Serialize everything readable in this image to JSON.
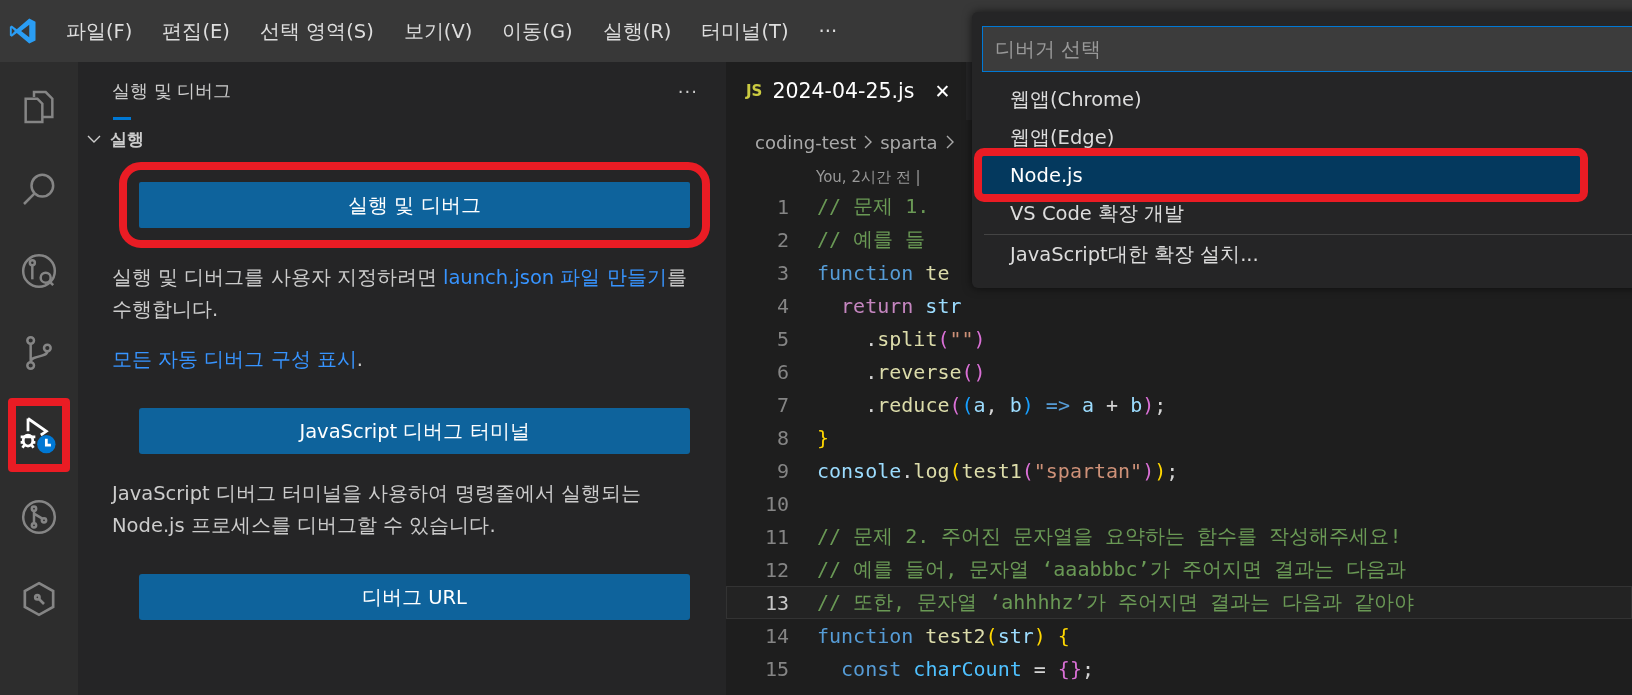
{
  "menu_bar": {
    "items": [
      "파일(F)",
      "편집(E)",
      "선택 영역(S)",
      "보기(V)",
      "이동(G)",
      "실행(R)",
      "터미널(T)"
    ],
    "more": "···"
  },
  "activity_bar": [
    {
      "kind": "files",
      "selected": false,
      "annotated": false
    },
    {
      "kind": "search",
      "selected": false,
      "annotated": false
    },
    {
      "kind": "remote",
      "selected": false,
      "annotated": false
    },
    {
      "kind": "source-control",
      "selected": false,
      "annotated": false
    },
    {
      "kind": "run-debug",
      "selected": true,
      "annotated": true
    },
    {
      "kind": "branch-circle",
      "selected": false,
      "annotated": false
    },
    {
      "kind": "hexagon",
      "selected": false,
      "annotated": false
    }
  ],
  "sidebar": {
    "title": "실행 및 디버그",
    "more": "···",
    "section": {
      "label": "실행",
      "expanded": true
    },
    "blocks": [
      {
        "kind": "button",
        "label": "실행 및 디버그",
        "annotated": true
      },
      {
        "kind": "paragraph",
        "parts": [
          {
            "kind": "text",
            "text": "실행 및 디버그를 사용자 지정하려면 "
          },
          {
            "kind": "link",
            "text": "launch.json 파일 만들기"
          },
          {
            "kind": "text",
            "text": "를 수행합니다."
          }
        ]
      },
      {
        "kind": "paragraph",
        "parts": [
          {
            "kind": "link",
            "text": "모든 자동 디버그 구성 표시"
          },
          {
            "kind": "text",
            "text": "."
          }
        ]
      },
      {
        "kind": "button",
        "label": "JavaScript 디버그 터미널",
        "annotated": false
      },
      {
        "kind": "paragraph",
        "parts": [
          {
            "kind": "text",
            "text": "JavaScript 디버그 터미널을 사용하여 명령줄에서 실행되는 Node.js 프로세스를 디버그할 수 있습니다."
          }
        ]
      },
      {
        "kind": "button",
        "label": "디버그 URL",
        "annotated": false
      }
    ]
  },
  "tabs": [
    {
      "badge": "JS",
      "label": "2024-04-25.js",
      "selected": true,
      "close": "✕"
    }
  ],
  "breadcrumb": [
    "coding-test",
    "sparta"
  ],
  "editor": {
    "code_lens": "You, 2시간 전 |",
    "lines": [
      {
        "number": "1",
        "current": false,
        "tokens": [
          {
            "kind": "comment",
            "text": "// 문제 1."
          }
        ]
      },
      {
        "number": "2",
        "current": false,
        "tokens": [
          {
            "kind": "comment",
            "text": "// 예를 들"
          }
        ]
      },
      {
        "number": "3",
        "current": false,
        "tokens": [
          {
            "kind": "keyword",
            "text": "function"
          },
          {
            "kind": "func",
            "text": " te"
          }
        ]
      },
      {
        "number": "4",
        "current": false,
        "tokens": [
          {
            "kind": "control",
            "text": "  return"
          },
          {
            "kind": "var",
            "text": " str"
          }
        ]
      },
      {
        "number": "5",
        "current": false,
        "tokens": [
          {
            "kind": "plain",
            "text": "    ."
          },
          {
            "kind": "func",
            "text": "split"
          },
          {
            "kind": "bracket2",
            "text": "("
          },
          {
            "kind": "string",
            "text": "\"\""
          },
          {
            "kind": "bracket2",
            "text": ")"
          }
        ]
      },
      {
        "number": "6",
        "current": false,
        "tokens": [
          {
            "kind": "plain",
            "text": "    ."
          },
          {
            "kind": "func",
            "text": "reverse"
          },
          {
            "kind": "bracket2",
            "text": "()"
          }
        ]
      },
      {
        "number": "7",
        "current": false,
        "tokens": [
          {
            "kind": "plain",
            "text": "    ."
          },
          {
            "kind": "func",
            "text": "reduce"
          },
          {
            "kind": "bracket2",
            "text": "("
          },
          {
            "kind": "bracket3",
            "text": "("
          },
          {
            "kind": "var",
            "text": "a"
          },
          {
            "kind": "plain",
            "text": ", "
          },
          {
            "kind": "var",
            "text": "b"
          },
          {
            "kind": "bracket3",
            "text": ")"
          },
          {
            "kind": "keyword",
            "text": " => "
          },
          {
            "kind": "var",
            "text": "a"
          },
          {
            "kind": "plain",
            "text": " + "
          },
          {
            "kind": "var",
            "text": "b"
          },
          {
            "kind": "bracket2",
            "text": ")"
          },
          {
            "kind": "plain",
            "text": ";"
          }
        ]
      },
      {
        "number": "8",
        "current": false,
        "tokens": [
          {
            "kind": "bracket1",
            "text": "}"
          }
        ]
      },
      {
        "number": "9",
        "current": false,
        "tokens": [
          {
            "kind": "var",
            "text": "console"
          },
          {
            "kind": "plain",
            "text": "."
          },
          {
            "kind": "func",
            "text": "log"
          },
          {
            "kind": "bracket1",
            "text": "("
          },
          {
            "kind": "func",
            "text": "test1"
          },
          {
            "kind": "bracket2",
            "text": "("
          },
          {
            "kind": "string",
            "text": "\"spartan\""
          },
          {
            "kind": "bracket2",
            "text": ")"
          },
          {
            "kind": "bracket1",
            "text": ")"
          },
          {
            "kind": "plain",
            "text": ";"
          }
        ]
      },
      {
        "number": "10",
        "current": false
      },
      {
        "number": "11",
        "current": false,
        "tokens": [
          {
            "kind": "comment",
            "text": "// 문제 2. 주어진 문자열을 요약하는 함수를 작성해주세요!"
          }
        ]
      },
      {
        "number": "12",
        "current": false,
        "tokens": [
          {
            "kind": "comment",
            "text": "// 예를 들어, 문자열 ‘aaabbbc’가 주어지면 결과는 다음과"
          }
        ]
      },
      {
        "number": "13",
        "current": true,
        "tokens": [
          {
            "kind": "comment",
            "text": "// 또한, 문자열 ‘ahhhhz’가 주어지면 결과는 다음과 같아야"
          }
        ]
      },
      {
        "number": "14",
        "current": false,
        "tokens": [
          {
            "kind": "keyword",
            "text": "function"
          },
          {
            "kind": "func",
            "text": " test2"
          },
          {
            "kind": "bracket1",
            "text": "("
          },
          {
            "kind": "var",
            "text": "str"
          },
          {
            "kind": "bracket1",
            "text": ") {"
          }
        ]
      },
      {
        "number": "15",
        "current": false,
        "tokens": [
          {
            "kind": "keyword",
            "text": "  const"
          },
          {
            "kind": "const",
            "text": " charCount"
          },
          {
            "kind": "plain",
            "text": " = "
          },
          {
            "kind": "bracket2",
            "text": "{}"
          },
          {
            "kind": "plain",
            "text": ";"
          }
        ]
      }
    ]
  },
  "quick_pick": {
    "placeholder": "디버거 선택",
    "items": [
      {
        "label": "웹앱(Chrome)",
        "selected": false,
        "separator": false,
        "annotated": false
      },
      {
        "label": "웹앱(Edge)",
        "selected": false,
        "separator": false,
        "annotated": false
      },
      {
        "label": "Node.js",
        "selected": true,
        "separator": false,
        "annotated": true
      },
      {
        "label": "VS Code 확장 개발",
        "selected": false,
        "separator": false,
        "annotated": false
      },
      {
        "label": "JavaScript대한 확장 설치...",
        "selected": false,
        "separator": true,
        "annotated": false
      }
    ]
  }
}
